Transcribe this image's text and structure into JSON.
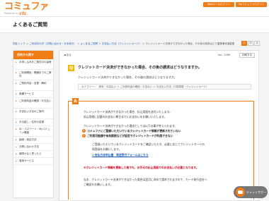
{
  "header": {
    "logo": "コミュファ",
    "powered": "Powered by",
    "brand": "ctc",
    "btn_mail": "Webメールログイン",
    "btn_mypage": "Myコミュファログイン"
  },
  "page_title": "よくあるご質問",
  "breadcrumb": {
    "items": [
      "同社トップ",
      "ご利用中の方（お問い合わせ・お手続き）",
      "よくあるご質問",
      "お支払い方法（クレジットカード）"
    ],
    "current": "クレジットカード決済ができなかった場合、その後の請求はどうなりますか。"
  },
  "font_size": {
    "label": "文字サイズ変更",
    "small": "小",
    "medium": "中",
    "large": "大"
  },
  "sidebar": {
    "heading": "目的から探す",
    "items": [
      "お申し込みをご検討中の皆様",
      "ご利用開始・開通までのご案内",
      "ご契約内容・変更・解約",
      "各種サービス",
      "ご利用料金の確認・お支払い",
      "お支払い方法のご案内",
      "お引越し・住所の変更",
      "ID・パスワード・Myコミュファ関連",
      "接続・設定方法",
      "お問い合わせ方法",
      "故障かなと思ったら",
      "運用サービス"
    ]
  },
  "main": {
    "back": "戻る",
    "no": "No：2269",
    "print": "印刷する",
    "q_mark": "Q",
    "question": "クレジットカード決済ができなかった場合、その後の請求はどうなりますか。",
    "q_sub": "クレジットカード決済ができなかった場合、その後の請求はどうなりますか。",
    "category": "カテゴリー：　請求・お支払い ＞ ご利用料金の確認・お支払い ＞ お支払い方法（口座振替・クレジットカード）",
    "a_mark": "A",
    "a_lines": [
      "クレジットカード決済ができなかった場合、払込用紙を送付いたします。",
      "払込用紙に記載のお支払い期日までにお支払いをお願いいたします。",
      "クレジットカード決済ができなかった理由としては以下の事が考えられます。"
    ],
    "reasons": [
      {
        "n": "1",
        "text": "コミュファにご登録いただいているクレジットカード情報が更新されていない"
      },
      {
        "n": "2",
        "text": "ご利用可能額や有効期限などが設定でクレジットカードが利用できない"
      }
    ],
    "sub_lines": [
      "ご登録いただいているクレジットカードをご確認いただき、必要に応じてクレジットカードの",
      "再登録をお願いします。"
    ],
    "link": "＞支払方法申込書　発送受付フォームはこちら",
    "warning": "※クレジットカード情報を更新した後でも、お手元の払込用紙でのお支払いが必要となります。",
    "tail_lines": [
      "なお、クレジットカード決済ができなかった場合は翌月に改めて請求されますので、カード発行会社へ",
      "ご確認をお願いします。"
    ]
  },
  "chat": "チャットサポート"
}
